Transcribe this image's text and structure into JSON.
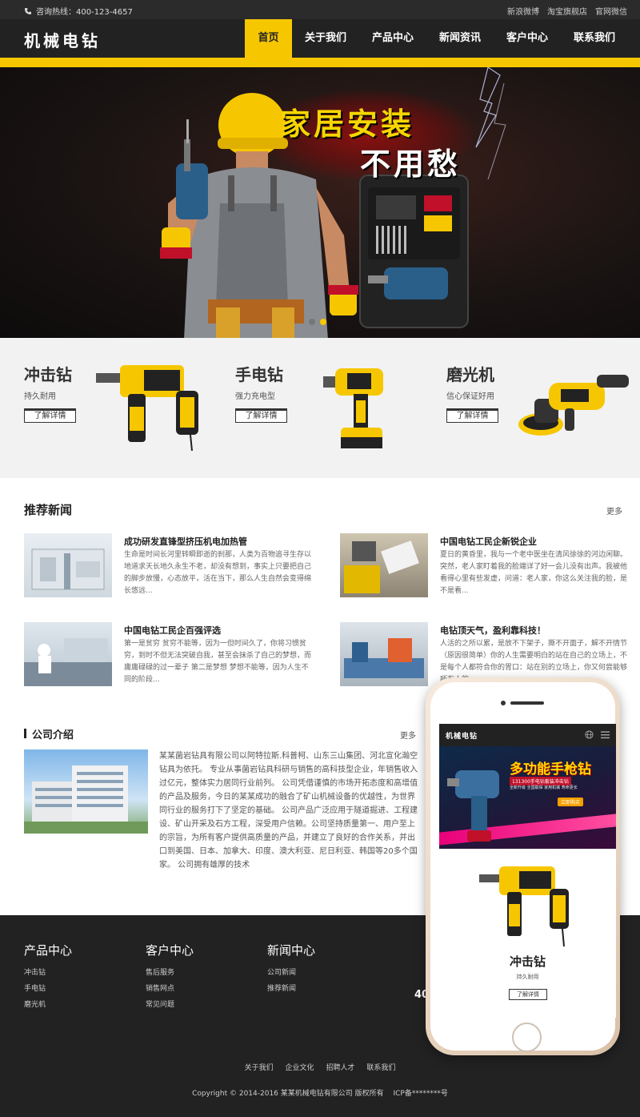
{
  "topbar": {
    "hotline": "咨询热线：400-123-4657",
    "links": [
      "新浪微博",
      "淘宝旗舰店",
      "官网微信"
    ]
  },
  "header": {
    "logo": "机械电钻",
    "nav": [
      "首页",
      "关于我们",
      "产品中心",
      "新闻资讯",
      "客户中心",
      "联系我们"
    ],
    "active_nav": "首页"
  },
  "banner": {
    "headline_line1": "家居安装",
    "headline_line2": "不用愁",
    "slides_count": 2,
    "active_slide": 2
  },
  "products": [
    {
      "title": "冲击钻",
      "subtitle": "持久耐用",
      "button": "了解详情"
    },
    {
      "title": "手电钻",
      "subtitle": "强力充电型",
      "button": "了解详情"
    },
    {
      "title": "磨光机",
      "subtitle": "信心保证好用",
      "button": "了解详情"
    }
  ],
  "news": {
    "title": "推荐新闻",
    "more": "更多",
    "items": [
      {
        "title": "成功研发直锋型挤压机电加热管",
        "desc": "生命是时间长河里转瞬即逝的刹那，人类为百物追寻生存以地道求天长地久永生不老，却没有想到，事实上只要把自己的脚步放慢，心态放平，活在当下，那么人生自然会变得绵长悠远..."
      },
      {
        "title": "中国电钻工民企新锐企业",
        "desc": "夏日的黄昏里，我与一个老中医坐在清风徐徐的河边闲聊。突然，老人家盯着我的脸端详了好一会儿没有出声。我被他看得心里有些发虚，问道：老人家，你这么关注我的脸，是不是看..."
      },
      {
        "title": "中国电钻工民企百强评选",
        "desc": "第一是贫穷 贫穷不能等，因为一但时间久了，你将习惯贫穷，到时不但无法突破自我，甚至会抹杀了自己的梦想，而庸庸碌碌的过一辈子 第二是梦想 梦想不能等，因为人生不同的阶段..."
      },
      {
        "title": "电钻顶天气，盈利靠科技！",
        "desc": "人活的之所以累，是放不下架子，撕不开面子，解不开情节（原因很简单）你的人生需要明白的站在自己的立场上，不是每个人都符合你的胃口：站在别的立场上，你又何尝能够所有人的..."
      }
    ]
  },
  "about": {
    "title": "公司介绍",
    "more": "更多",
    "text": "某某菌岩钻具有限公司以阿特拉斯.科普柯、山东三山集团、河北宣化瀚空钻具为依托。 专业从事菌岩钻具科研与销售的高科技型企业，年销售收入过亿元，整体实力居同行业前列。 公司凭借谨慎的市场开拓态度和高增值的产品及服务，今日的某某成功的融合了矿山机械设备的优越性，为世界同行业的服务打下了坚定的基础。 公司产品广泛应用于隧道掘进、工程建设、矿山开采及石方工程，深受用户信赖。公司坚持质量第一、用户至上的宗旨，为所有客户提供高质量的产品，并建立了良好的合作关系，并出口到美国、日本、加拿大、印度、澳大利亚、尼日利亚、韩国等20多个国家。 公司拥有雄厚的技术"
  },
  "footer": {
    "columns": [
      {
        "head": "产品中心",
        "links": [
          "冲击钻",
          "手电钻",
          "磨光机"
        ]
      },
      {
        "head": "客户中心",
        "links": [
          "售后服务",
          "销售网点",
          "常见问题"
        ]
      },
      {
        "head": "新闻中心",
        "links": [
          "公司新闻",
          "推荐新闻"
        ]
      }
    ],
    "phone_fragment": "40",
    "bottom_links": [
      "关于我们",
      "企业文化",
      "招聘人才",
      "联系我们"
    ],
    "copyright": "Copyright © 2014-2016 某某机械电钻有限公司 版权所有 　ICP备********号"
  },
  "mobile": {
    "logo": "机械电钻",
    "banner_title": "多功能手枪钻",
    "banner_sub": "131300手电钻套装冲击钻",
    "banner_tags": "全新升级 全国联保 家用机械 寿命更长",
    "banner_button": "立即购买",
    "product_title": "冲击钻",
    "product_sub": "持久耐用",
    "product_button": "了解详情"
  },
  "colors": {
    "accent": "#f6c700",
    "dark": "#222222",
    "topbar": "#2b2b2b"
  }
}
